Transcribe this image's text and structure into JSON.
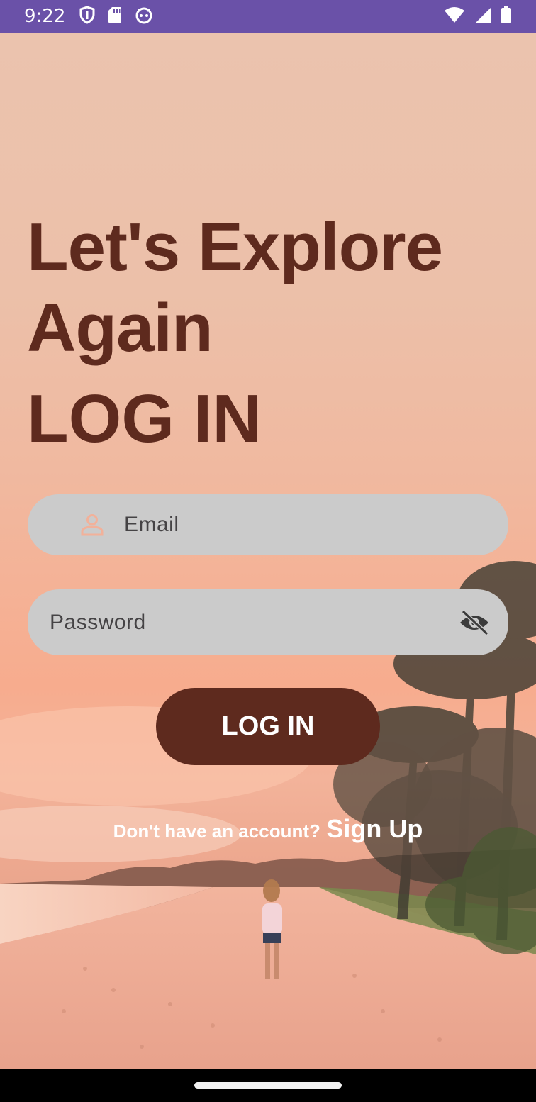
{
  "status_bar": {
    "time": "9:22",
    "left_icons": [
      "shield-icon",
      "sd-card-icon",
      "android-face-icon"
    ],
    "right_icons": [
      "wifi-icon",
      "cell-signal-icon",
      "battery-icon"
    ],
    "color": "#6a51a8"
  },
  "headline": {
    "line1": "Let's Explore",
    "line2": "Again"
  },
  "login_title": "LOG IN",
  "email_field": {
    "placeholder": "Email",
    "icon": "person-icon"
  },
  "password_field": {
    "placeholder": "Password",
    "icon": "eye-off-icon"
  },
  "login_button": {
    "label": "LOG IN",
    "color": "#5e2a1e"
  },
  "signup": {
    "prompt": "Don't have an account?",
    "link_label": "Sign Up"
  },
  "colors": {
    "heading": "#5e2a1e",
    "field_bg": "#cbcbcb",
    "icon_accent": "#f2b19a"
  }
}
